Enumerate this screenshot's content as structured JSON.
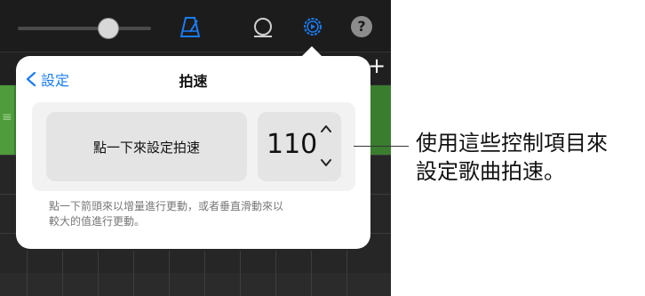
{
  "popover": {
    "back_label": "設定",
    "title": "拍速",
    "tap_button_label": "點一下來設定拍速",
    "tempo_value": "110",
    "hint_line1": "點一下箭頭來以增量進行更動，或者垂直滑動來以",
    "hint_line2": "較大的值進行更動。"
  },
  "callout": {
    "line1": "使用這些控制項目來",
    "line2": "設定歌曲拍速。"
  },
  "colors": {
    "accent": "#1a7cf5",
    "toolbar_bg": "#1c1c1c",
    "track_green": "#3a7d2f"
  },
  "icons": {
    "metronome": "metronome-icon",
    "loop": "loop-icon",
    "settings": "gear-icon",
    "help": "help-icon",
    "add": "plus-icon"
  },
  "toolbar": {
    "help_glyph": "?",
    "add_glyph": "+"
  },
  "app": {
    "track_header_glyph": "≡"
  }
}
